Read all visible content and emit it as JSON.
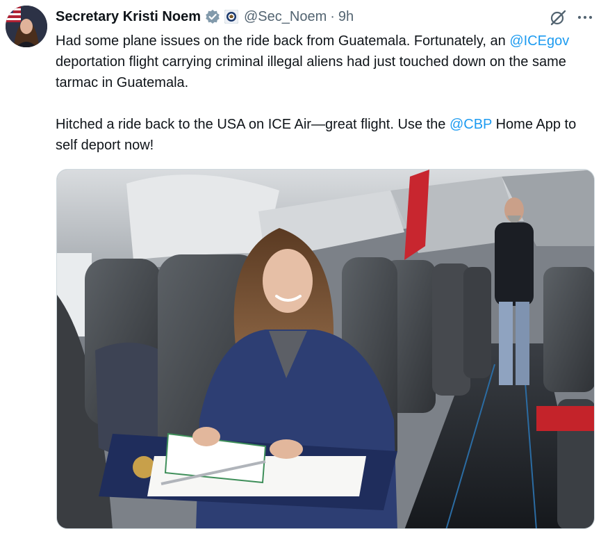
{
  "author": {
    "display_name": "Secretary Kristi Noem",
    "handle": "@Sec_Noem",
    "separator": "·",
    "time": "9h"
  },
  "tweet": {
    "p1_pre": "Had some plane issues on the ride back from Guatemala. Fortunately, an ",
    "p1_mention": "@ICEgov",
    "p1_post": " deportation flight carrying criminal illegal aliens had just touched down on the same tarmac in Guatemala.",
    "p2_pre": "Hitched a ride back to the USA on ICE Air—great flight. Use the ",
    "p2_mention": "@CBP",
    "p2_post": " Home App to self deport now!"
  },
  "icons": {
    "verified": "verified-badge-icon",
    "affiliation": "dhs-seal-icon",
    "grok": "grok-icon",
    "more": "more-options-icon"
  },
  "colors": {
    "text": "#0f1419",
    "secondary": "#536471",
    "link": "#1d9bf0",
    "border": "#cfd9de",
    "jacket": "#2d3e73",
    "folder": "#1f2d5c"
  }
}
